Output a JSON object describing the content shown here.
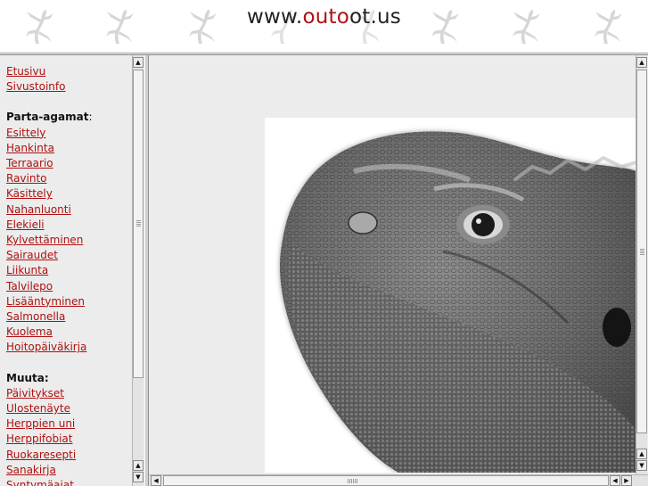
{
  "header": {
    "title_prefix": "www.",
    "title_highlight": "outo",
    "title_suffix": "ot.us",
    "highlight_color": "#b01010"
  },
  "nav": {
    "top_links": [
      "Etusivu",
      "Sivustoinfo"
    ],
    "section1_heading": "Parta-agamat",
    "section1_colon": ":",
    "section1_links": [
      "Esittely",
      "Hankinta",
      "Terraario",
      "Ravinto",
      "Käsittely",
      "Nahanluonti",
      "Elekieli",
      "Kylvettäminen",
      "Sairaudet",
      "Liikunta",
      "Talvilepo",
      "Lisääntyminen",
      "Salmonella",
      "Kuolema",
      "Hoitopäiväkirja"
    ],
    "section2_heading": "Muuta:",
    "section2_links": [
      "Päivitykset",
      "Ulostenäyte",
      "Herppien uni",
      "Herppifobiat",
      "Ruokaresepti",
      "Sanakirja",
      "Syntymäajat"
    ],
    "link_color": "#b01010"
  },
  "main": {
    "image_subject": "bearded-dragon-head-photo"
  },
  "icons": {
    "header_decoration": "gecko-silhouette-icon",
    "scroll_up": "arrow-up-icon",
    "scroll_down": "arrow-down-icon",
    "scroll_left": "arrow-left-icon",
    "scroll_right": "arrow-right-icon"
  }
}
